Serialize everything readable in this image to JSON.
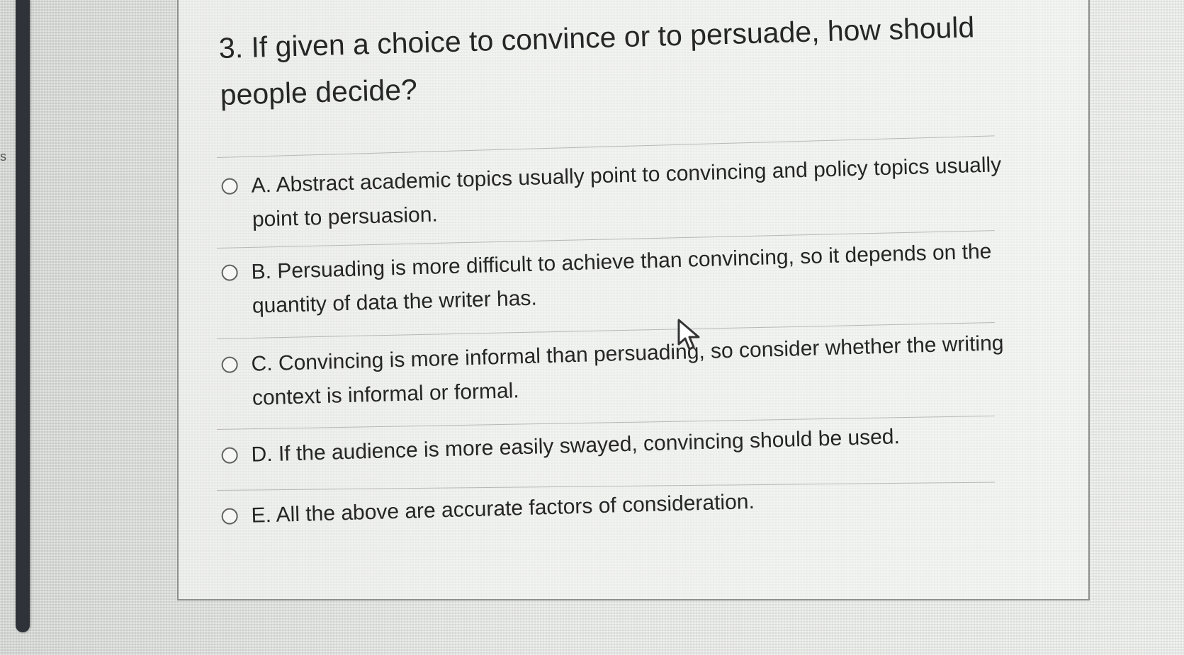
{
  "page": {
    "edge_text": "s"
  },
  "question": {
    "text": "3. If given a choice to convince or to persuade, how should people decide?"
  },
  "answers": [
    {
      "label": "A. Abstract academic topics usually point to convincing and policy topics usually point to persuasion."
    },
    {
      "label": "B. Persuading is more difficult to achieve than convincing, so it depends on the quantity of data the writer has."
    },
    {
      "label": "C. Convincing is more informal than persuading, so consider whether the writing context is informal or formal."
    },
    {
      "label": "D. If the audience is more easily swayed, convincing should be used."
    },
    {
      "label": "E. All the above are accurate factors of consideration."
    }
  ],
  "icons": {
    "cursor": "mouse-pointer-icon",
    "radio": "radio-button-icon"
  },
  "colors": {
    "sidebar": "#2f3339",
    "text": "#262626",
    "divider": "#b7b9b6"
  }
}
